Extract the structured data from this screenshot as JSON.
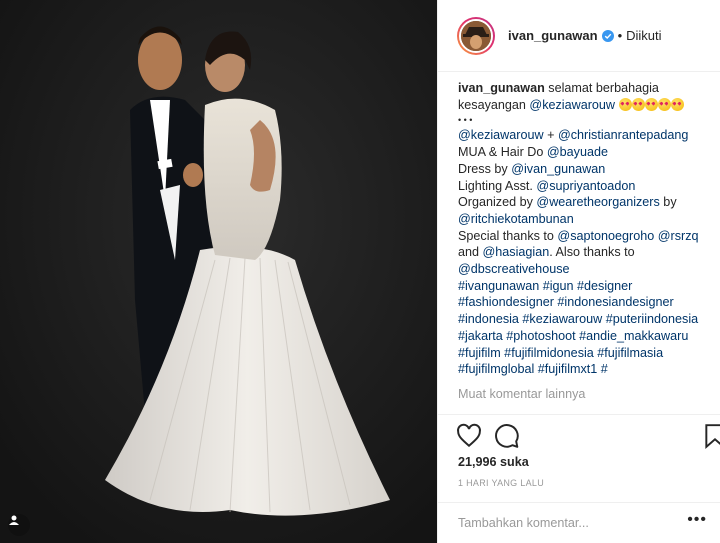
{
  "post": {
    "username": "ivan_gunawan",
    "follow_status": "Diikuti",
    "dot": "•"
  },
  "caption": {
    "author": "ivan_gunawan",
    "line1_text": " selamat berbahagia",
    "line2_text": "kesayangan ",
    "line2_mention": "@keziawarouw",
    "emoji_count": 5,
    "dots_line": "•  •  •",
    "line4_m1": "@keziawarouw",
    "line4_plus": " + ",
    "line4_m2": "@christianrantepadang",
    "line5_text": "MUA & Hair Do ",
    "line5_m": "@bayuade",
    "line6_text": "Dress by ",
    "line6_m": "@ivan_gunawan",
    "line7_text": "Lighting Asst. ",
    "line7_m": "@supriyantoadon",
    "line8_text": "Organized by ",
    "line8_m": "@wearetheorganizers",
    "line8_tail": " by",
    "line9_m": "@ritchiekotambunan",
    "line10_text": "Special thanks to ",
    "line10_m1": "@saptonoegroho",
    "line10_m2": "@rsrzq",
    "line11_text": "and ",
    "line11_m": "@hasiagian",
    "line11_tail": ". Also thanks to",
    "line12_m": "@dbscreativehouse",
    "hashtags": [
      "#ivangunawan #igun #designer",
      "#fashiondesigner #indonesiandesigner",
      "#indonesia #keziawarouw #puteriindonesia",
      "#jakarta #photoshoot #andie_makkawaru",
      "#fujifilm #fujifilmidonesia #fujifilmasia",
      "#fujifilmglobal #fujifilmxt1 #"
    ]
  },
  "more_comments": "Muat komentar lainnya",
  "likes": "21,996 suka",
  "time_ago": "1 HARI YANG LALU",
  "comment_input": {
    "placeholder": "Tambahkan komentar..."
  },
  "options_glyph": "•••",
  "colors": {
    "link": "#003569",
    "muted": "#999999",
    "verified": "#3897f0"
  }
}
